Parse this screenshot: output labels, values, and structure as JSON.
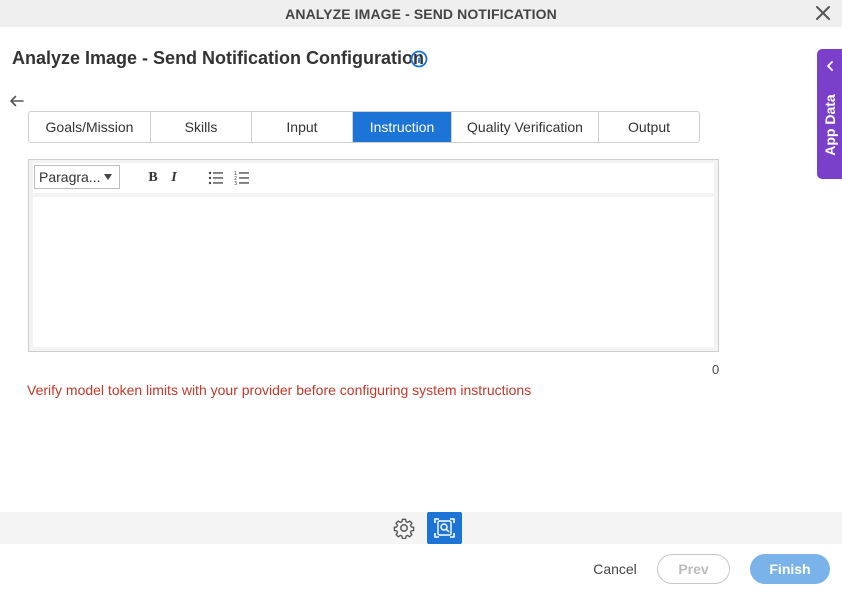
{
  "window": {
    "title": "ANALYZE IMAGE - SEND NOTIFICATION"
  },
  "page": {
    "heading": "Analyze Image - Send Notification Configuration"
  },
  "tabs": [
    {
      "label": "Goals/Mission",
      "active": false
    },
    {
      "label": "Skills",
      "active": false
    },
    {
      "label": "Input",
      "active": false
    },
    {
      "label": "Instruction",
      "active": true
    },
    {
      "label": "Quality Verification",
      "active": false
    },
    {
      "label": "Output",
      "active": false
    }
  ],
  "editor": {
    "paragraph_select": "Paragra...",
    "bold_label": "B",
    "italic_label": "I",
    "content": "",
    "char_count": "0"
  },
  "warning": "Verify model token limits with your provider before configuring system instructions",
  "footer": {
    "cancel": "Cancel",
    "prev": "Prev",
    "finish": "Finish"
  },
  "side_panel": {
    "label": "App Data"
  },
  "colors": {
    "accent": "#1b74d6",
    "side_panel": "#7b40c9",
    "warning": "#c0392b",
    "finish_disabled": "#7ab3ea"
  },
  "icons": [
    "close-icon",
    "info-icon",
    "back-arrow-icon",
    "bullet-list-icon",
    "numbered-list-icon",
    "gear-icon",
    "image-scan-icon",
    "chevron-left-icon"
  ]
}
